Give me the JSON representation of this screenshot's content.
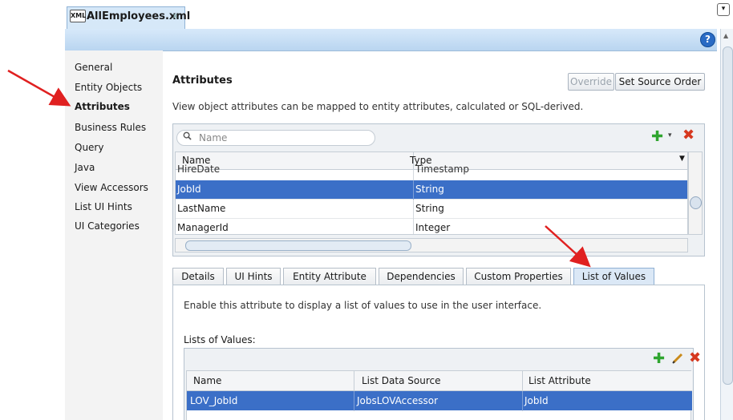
{
  "editor_tab": {
    "title": "AllEmployees.xml",
    "close_glyph": "x",
    "icon_label": "XML"
  },
  "help_glyph": "?",
  "tab_menu_glyph": "▾",
  "nav": [
    {
      "label": "General",
      "active": false
    },
    {
      "label": "Entity Objects",
      "active": false
    },
    {
      "label": "Attributes",
      "active": true
    },
    {
      "label": "Business Rules",
      "active": false
    },
    {
      "label": "Query",
      "active": false
    },
    {
      "label": "Java",
      "active": false
    },
    {
      "label": "View Accessors",
      "active": false
    },
    {
      "label": "List UI Hints",
      "active": false
    },
    {
      "label": "UI Categories",
      "active": false
    }
  ],
  "attributes": {
    "title": "Attributes",
    "override_label": "Override",
    "set_source_order_label": "Set Source Order",
    "description": "View object attributes can be mapped to entity attributes, calculated or SQL-derived.",
    "search_placeholder": "Name",
    "columns": [
      "Name",
      "Type"
    ],
    "partial_row": {
      "name": "HireDate",
      "type": "Timestamp"
    },
    "rows": [
      {
        "name": "JobId",
        "type": "String",
        "selected": true
      },
      {
        "name": "LastName",
        "type": "String",
        "selected": false
      },
      {
        "name": "ManagerId",
        "type": "Integer",
        "selected": false
      }
    ]
  },
  "detail_tabs": [
    {
      "label": "Details",
      "active": false
    },
    {
      "label": "UI Hints",
      "active": false
    },
    {
      "label": "Entity Attribute",
      "active": false
    },
    {
      "label": "Dependencies",
      "active": false
    },
    {
      "label": "Custom Properties",
      "active": false
    },
    {
      "label": "List of Values",
      "active": true
    }
  ],
  "lov": {
    "description": "Enable this attribute to display a list of values to use in the user interface.",
    "section_label": "Lists of Values:",
    "columns": [
      "Name",
      "List Data Source",
      "List Attribute"
    ],
    "rows": [
      {
        "name": "LOV_JobId",
        "data_source": "JobsLOVAccessor",
        "attribute": "JobId"
      }
    ]
  },
  "colors": {
    "selection": "#3b6fc7",
    "add_green": "#2fa52f",
    "delete_red": "#d6381f",
    "annotation_red": "#e02020"
  }
}
